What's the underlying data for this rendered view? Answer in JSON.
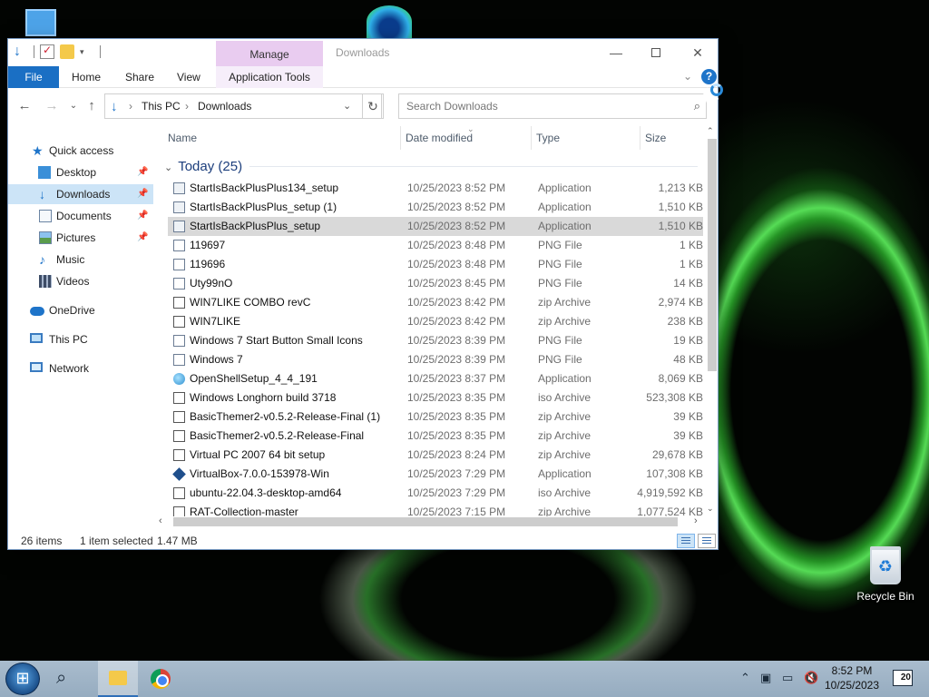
{
  "window": {
    "title": "Downloads",
    "manage_tab": "Manage",
    "min": "—",
    "max": "",
    "close": "✕"
  },
  "ribbon": {
    "file": "File",
    "home": "Home",
    "share": "Share",
    "view": "View",
    "app_tools": "Application Tools",
    "help": "?"
  },
  "address": {
    "crumbs": [
      "›",
      "This PC",
      "›",
      "Downloads"
    ],
    "search_placeholder": "Search Downloads"
  },
  "nav": {
    "items": [
      {
        "label": "Quick access",
        "icon": "star-icon"
      },
      {
        "label": "Desktop",
        "icon": "desktop-icon"
      },
      {
        "label": "Downloads",
        "icon": "download-icon"
      },
      {
        "label": "Documents",
        "icon": "documents-icon"
      },
      {
        "label": "Pictures",
        "icon": "pictures-icon"
      },
      {
        "label": "Music",
        "icon": "music-icon"
      },
      {
        "label": "Videos",
        "icon": "videos-icon"
      },
      {
        "label": "OneDrive",
        "icon": "cloud-icon"
      },
      {
        "label": "This PC",
        "icon": "computer-icon"
      },
      {
        "label": "Network",
        "icon": "network-icon"
      }
    ]
  },
  "columns": {
    "name": "Name",
    "date": "Date modified",
    "type": "Type",
    "size": "Size"
  },
  "group": {
    "label": "Today (25)"
  },
  "files": [
    {
      "name": "StartIsBackPlusPlus134_setup",
      "date": "10/25/2023 8:52 PM",
      "type": "Application",
      "size": "1,213 KB",
      "icon": "app"
    },
    {
      "name": "StartIsBackPlusPlus_setup (1)",
      "date": "10/25/2023 8:52 PM",
      "type": "Application",
      "size": "1,510 KB",
      "icon": "app"
    },
    {
      "name": "StartIsBackPlusPlus_setup",
      "date": "10/25/2023 8:52 PM",
      "type": "Application",
      "size": "1,510 KB",
      "icon": "app",
      "selected": true
    },
    {
      "name": "119697",
      "date": "10/25/2023 8:48 PM",
      "type": "PNG File",
      "size": "1 KB",
      "icon": "png"
    },
    {
      "name": "119696",
      "date": "10/25/2023 8:48 PM",
      "type": "PNG File",
      "size": "1 KB",
      "icon": "png"
    },
    {
      "name": "Uty99nO",
      "date": "10/25/2023 8:45 PM",
      "type": "PNG File",
      "size": "14 KB",
      "icon": "png"
    },
    {
      "name": "WIN7LIKE COMBO revC",
      "date": "10/25/2023 8:42 PM",
      "type": "zip Archive",
      "size": "2,974 KB",
      "icon": "zip"
    },
    {
      "name": "WIN7LIKE",
      "date": "10/25/2023 8:42 PM",
      "type": "zip Archive",
      "size": "238 KB",
      "icon": "zip"
    },
    {
      "name": "Windows 7 Start Button Small Icons",
      "date": "10/25/2023 8:39 PM",
      "type": "PNG File",
      "size": "19 KB",
      "icon": "png"
    },
    {
      "name": "Windows 7",
      "date": "10/25/2023 8:39 PM",
      "type": "PNG File",
      "size": "48 KB",
      "icon": "png"
    },
    {
      "name": "OpenShellSetup_4_4_191",
      "date": "10/25/2023 8:37 PM",
      "type": "Application",
      "size": "8,069 KB",
      "icon": "globe"
    },
    {
      "name": "Windows Longhorn build 3718",
      "date": "10/25/2023 8:35 PM",
      "type": "iso Archive",
      "size": "523,308 KB",
      "icon": "iso"
    },
    {
      "name": "BasicThemer2-v0.5.2-Release-Final (1)",
      "date": "10/25/2023 8:35 PM",
      "type": "zip Archive",
      "size": "39 KB",
      "icon": "zip"
    },
    {
      "name": "BasicThemer2-v0.5.2-Release-Final",
      "date": "10/25/2023 8:35 PM",
      "type": "zip Archive",
      "size": "39 KB",
      "icon": "zip"
    },
    {
      "name": "Virtual PC 2007 64 bit setup",
      "date": "10/25/2023 8:24 PM",
      "type": "zip Archive",
      "size": "29,678 KB",
      "icon": "zip"
    },
    {
      "name": "VirtualBox-7.0.0-153978-Win",
      "date": "10/25/2023 7:29 PM",
      "type": "Application",
      "size": "107,308 KB",
      "icon": "vbox"
    },
    {
      "name": "ubuntu-22.04.3-desktop-amd64",
      "date": "10/25/2023 7:29 PM",
      "type": "iso Archive",
      "size": "4,919,592 KB",
      "icon": "iso"
    },
    {
      "name": "RAT-Collection-master",
      "date": "10/25/2023 7:15 PM",
      "type": "zip Archive",
      "size": "1,077,524 KB",
      "icon": "zip"
    }
  ],
  "status": {
    "count": "26 items",
    "selected": "1 item selected",
    "size": "1.47 MB"
  },
  "desktop": {
    "recycle_bin": "Recycle Bin"
  },
  "taskbar": {
    "time": "8:52 PM",
    "date": "10/25/2023",
    "notifications": "20"
  }
}
